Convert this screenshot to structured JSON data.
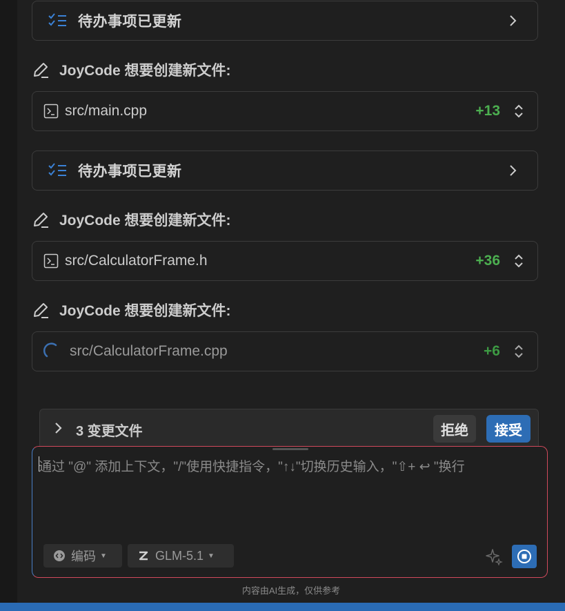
{
  "todo_updated": "待办事项已更新",
  "create_heading": "JoyCode 想要创建新文件:",
  "files": [
    {
      "name": "src/main.cpp",
      "added": "+13",
      "state": "done"
    },
    {
      "name": "src/CalculatorFrame.h",
      "added": "+36",
      "state": "done"
    },
    {
      "name": "src/CalculatorFrame.cpp",
      "added": "+6",
      "state": "loading"
    }
  ],
  "changes": {
    "label": "3 变更文件",
    "reject": "拒绝",
    "accept": "接受"
  },
  "input": {
    "placeholder": "通过 \"@\" 添加上下文，\"/\"使用快捷指令，\"↑↓\"切换历史输入，\"⇧+ ↩ \"换行"
  },
  "mode_select": {
    "value": "编码",
    "icon": "code-icon"
  },
  "model_select": {
    "value": "GLM-5.1",
    "icon": "zhipu-logo-icon"
  },
  "disclaimer": "内容由AI生成，仅供参考",
  "colors": {
    "accent": "#2d6db5",
    "added": "#4caf50",
    "todo_icon": "#3b82d6",
    "border_focus_red": "#d24a5c",
    "border_focus_blue": "#4a80c8"
  }
}
